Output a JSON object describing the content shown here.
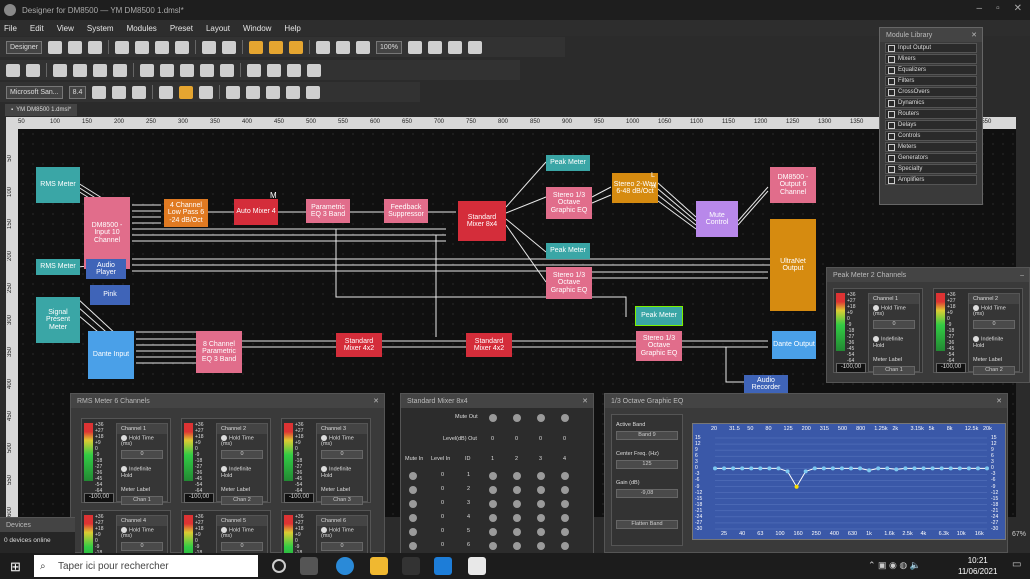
{
  "window": {
    "title": "Designer for DM8500 — YM DM8500 1.dmsl*"
  },
  "menu": [
    "File",
    "Edit",
    "View",
    "System",
    "Modules",
    "Preset",
    "Layout",
    "Window",
    "Help"
  ],
  "toolbar": {
    "mode": "Designer",
    "zoom": "100%",
    "font": "Microsoft San...",
    "font_size": "8.4"
  },
  "doc_tab": "YM DM8500 1.dmsl*",
  "ruler_marks": [
    "50",
    "100",
    "150",
    "200",
    "250",
    "300",
    "350",
    "400",
    "450",
    "500",
    "550",
    "600",
    "650",
    "700",
    "750",
    "800",
    "850",
    "900",
    "950",
    "1000",
    "1050",
    "1100",
    "1150",
    "1200",
    "1250",
    "1300",
    "1350",
    "1400",
    "1450",
    "1500",
    "1550"
  ],
  "ruler_vmarks": [
    "50",
    "100",
    "150",
    "200",
    "250",
    "300",
    "350",
    "400",
    "450",
    "500",
    "550",
    "600"
  ],
  "blocks": {
    "rms1": "RMS Meter",
    "input10": "DM8500 - Input 10 Channel",
    "rms2": "RMS Meter",
    "audio_player": "Audio Player",
    "pink": "Pink",
    "signal_presence": "Signal Present Meter",
    "dante_input": "Dante Input",
    "lowpass": "4 Channel Low Pass 6 -24 dB/Oct",
    "automixer": "Auto Mixer 4",
    "automixer_tag": "M",
    "peq3": "Parametric EQ 3 Band",
    "feedback": "Feedback Suppressor",
    "mixer8x4": "Standard Mixer 8x4",
    "peak1": "Peak Meter",
    "geq1": "Stereo 1/3 Octave Graphic EQ",
    "xover": "Stereo 2-Way 6-48 dB/Oct",
    "xover_l": "L",
    "xover_h": "H",
    "mute": "Mute Control",
    "output6": "DM8500 - Output 6 Channel",
    "peak2": "Peak Meter",
    "geq2": "Stereo 1/3 Octave Graphic EQ",
    "ultranet": "UltraNet Output",
    "peq8": "8 Channel Parametric EQ 3 Band",
    "mixer4x2a": "Standard Mixer 4x2",
    "mixer4x2b": "Standard Mixer 4x2",
    "peak3": "Peak Meter",
    "geq3": "Stereo 1/3 Octave Graphic EQ",
    "dante_output": "Dante Output",
    "audio_recorder": "Audio Recorder"
  },
  "module_library": {
    "title": "Module Library",
    "items": [
      "Input Output",
      "Mixers",
      "Equalizers",
      "Filters",
      "CrossOvers",
      "Dynamics",
      "Routers",
      "Delays",
      "Controls",
      "Meters",
      "Generators",
      "Specialty",
      "Amplifiers"
    ]
  },
  "peak_panel": {
    "title": "Peak Meter 2 Channels",
    "channels": [
      {
        "name": "Channel 1",
        "label": "Chan 1",
        "value": "-100,00"
      },
      {
        "name": "Channel 2",
        "label": "Chan 2",
        "value": "-100,00"
      }
    ]
  },
  "rms_panel": {
    "title": "RMS Meter 6 Channels",
    "channels": [
      {
        "name": "Channel 1",
        "label": "Chan 1",
        "value": "-100,00"
      },
      {
        "name": "Channel 2",
        "label": "Chan 2",
        "value": "-100,00"
      },
      {
        "name": "Channel 3",
        "label": "Chan 3",
        "value": "-100,00"
      },
      {
        "name": "Channel 4"
      },
      {
        "name": "Channel 5"
      },
      {
        "name": "Channel 6"
      }
    ]
  },
  "channel_labels": {
    "hold": "Hold Time (ms)",
    "hold_value": "0",
    "indef": "Indefinite Hold",
    "meter_label": "Meter Label"
  },
  "meter_scale": [
    "+36",
    "+27",
    "+18",
    "+9",
    "0",
    "-9",
    "-18",
    "-27",
    "-36",
    "-45",
    "-54",
    "-64"
  ],
  "mixer_panel": {
    "title": "Standard Mixer 8x4",
    "mute_out": "Mute Out",
    "level_out": "Level(dB) Out",
    "level_vals": [
      "0",
      "0",
      "0",
      "0"
    ],
    "mute_in": "Mute In",
    "level_in": "Level In",
    "id": "ID",
    "cols": [
      "1",
      "2",
      "3",
      "4"
    ],
    "rows": [
      {
        "lvl": "0",
        "id": "1"
      },
      {
        "lvl": "0",
        "id": "2"
      },
      {
        "lvl": "0",
        "id": "3"
      },
      {
        "lvl": "0",
        "id": "4"
      },
      {
        "lvl": "0",
        "id": "5"
      },
      {
        "lvl": "0",
        "id": "6"
      }
    ]
  },
  "geq_panel": {
    "title": "1/3 Octave Graphic EQ",
    "active_band_label": "Active Band",
    "active_band": "Band 9",
    "center_label": "Center Freq. (Hz)",
    "center": "125",
    "gain_label": "Gain (dB)",
    "gain": "-9,08",
    "flatten": "Flatten Band",
    "top_freqs": [
      "20",
      "31.5",
      "50",
      "80",
      "125",
      "200",
      "315",
      "500",
      "800",
      "1.25k",
      "2k",
      "3.15k",
      "5k",
      "8k",
      "12.5k",
      "20k"
    ],
    "bottom_freqs": [
      "25",
      "40",
      "63",
      "100",
      "160",
      "250",
      "400",
      "630",
      "1k",
      "1.6k",
      "2.5k",
      "4k",
      "6.3k",
      "10k",
      "16k"
    ],
    "db_scale": [
      "15",
      "12",
      "9",
      "6",
      "3",
      "0",
      "-3",
      "-6",
      "-9",
      "-12",
      "-15",
      "-18",
      "-21",
      "-24",
      "-27",
      "-30"
    ]
  },
  "devices": {
    "title": "Devices",
    "status": "0 devices online"
  },
  "zoom_corner": "67%",
  "taskbar": {
    "search": "Taper ici pour rechercher",
    "time": "10:21",
    "date": "11/06/2021"
  }
}
